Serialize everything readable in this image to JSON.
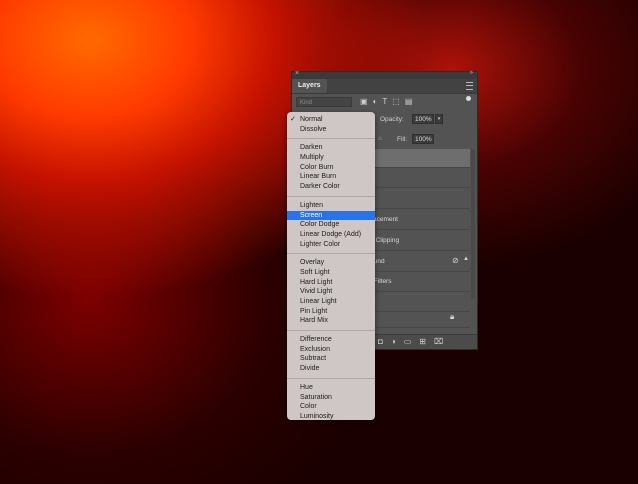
{
  "panel": {
    "tab_label": "Layers",
    "filter": {
      "placeholder": "Kind",
      "icons": [
        "image-filter-icon",
        "adjustment-filter-icon",
        "type-filter-icon",
        "shape-filter-icon",
        "smart-object-filter-icon"
      ]
    },
    "opacity_label": "Opacity:",
    "opacity_value": "100%",
    "fill_label": "Fill:",
    "fill_value": "100%",
    "layers": [
      {
        "visible_text": "",
        "selected": true
      },
      {
        "visible_text": ""
      },
      {
        "visible_text": ""
      },
      {
        "visible_text": "placement"
      },
      {
        "visible_text": "ar Clipping"
      },
      {
        "visible_text": "round"
      },
      {
        "visible_text": "rt Filters"
      },
      {
        "visible_text": "ry"
      },
      {
        "visible_text": ""
      }
    ],
    "bottom_icons": [
      "mask-icon",
      "adjustment-icon",
      "group-folder-icon",
      "new-layer-icon",
      "trash-icon"
    ]
  },
  "blend_menu": {
    "groups": [
      [
        {
          "label": "Normal",
          "checked": true
        },
        {
          "label": "Dissolve"
        }
      ],
      [
        {
          "label": "Darken"
        },
        {
          "label": "Multiply"
        },
        {
          "label": "Color Burn"
        },
        {
          "label": "Linear Burn"
        },
        {
          "label": "Darker Color"
        }
      ],
      [
        {
          "label": "Lighten"
        },
        {
          "label": "Screen",
          "highlighted": true
        },
        {
          "label": "Color Dodge"
        },
        {
          "label": "Linear Dodge (Add)"
        },
        {
          "label": "Lighter Color"
        }
      ],
      [
        {
          "label": "Overlay"
        },
        {
          "label": "Soft Light"
        },
        {
          "label": "Hard Light"
        },
        {
          "label": "Vivid Light"
        },
        {
          "label": "Linear Light"
        },
        {
          "label": "Pin Light"
        },
        {
          "label": "Hard Mix"
        }
      ],
      [
        {
          "label": "Difference"
        },
        {
          "label": "Exclusion"
        },
        {
          "label": "Subtract"
        },
        {
          "label": "Divide"
        }
      ],
      [
        {
          "label": "Hue"
        },
        {
          "label": "Saturation"
        },
        {
          "label": "Color"
        },
        {
          "label": "Luminosity"
        }
      ]
    ],
    "check_glyph": "✓",
    "highlight_color": "#2a72e8"
  }
}
